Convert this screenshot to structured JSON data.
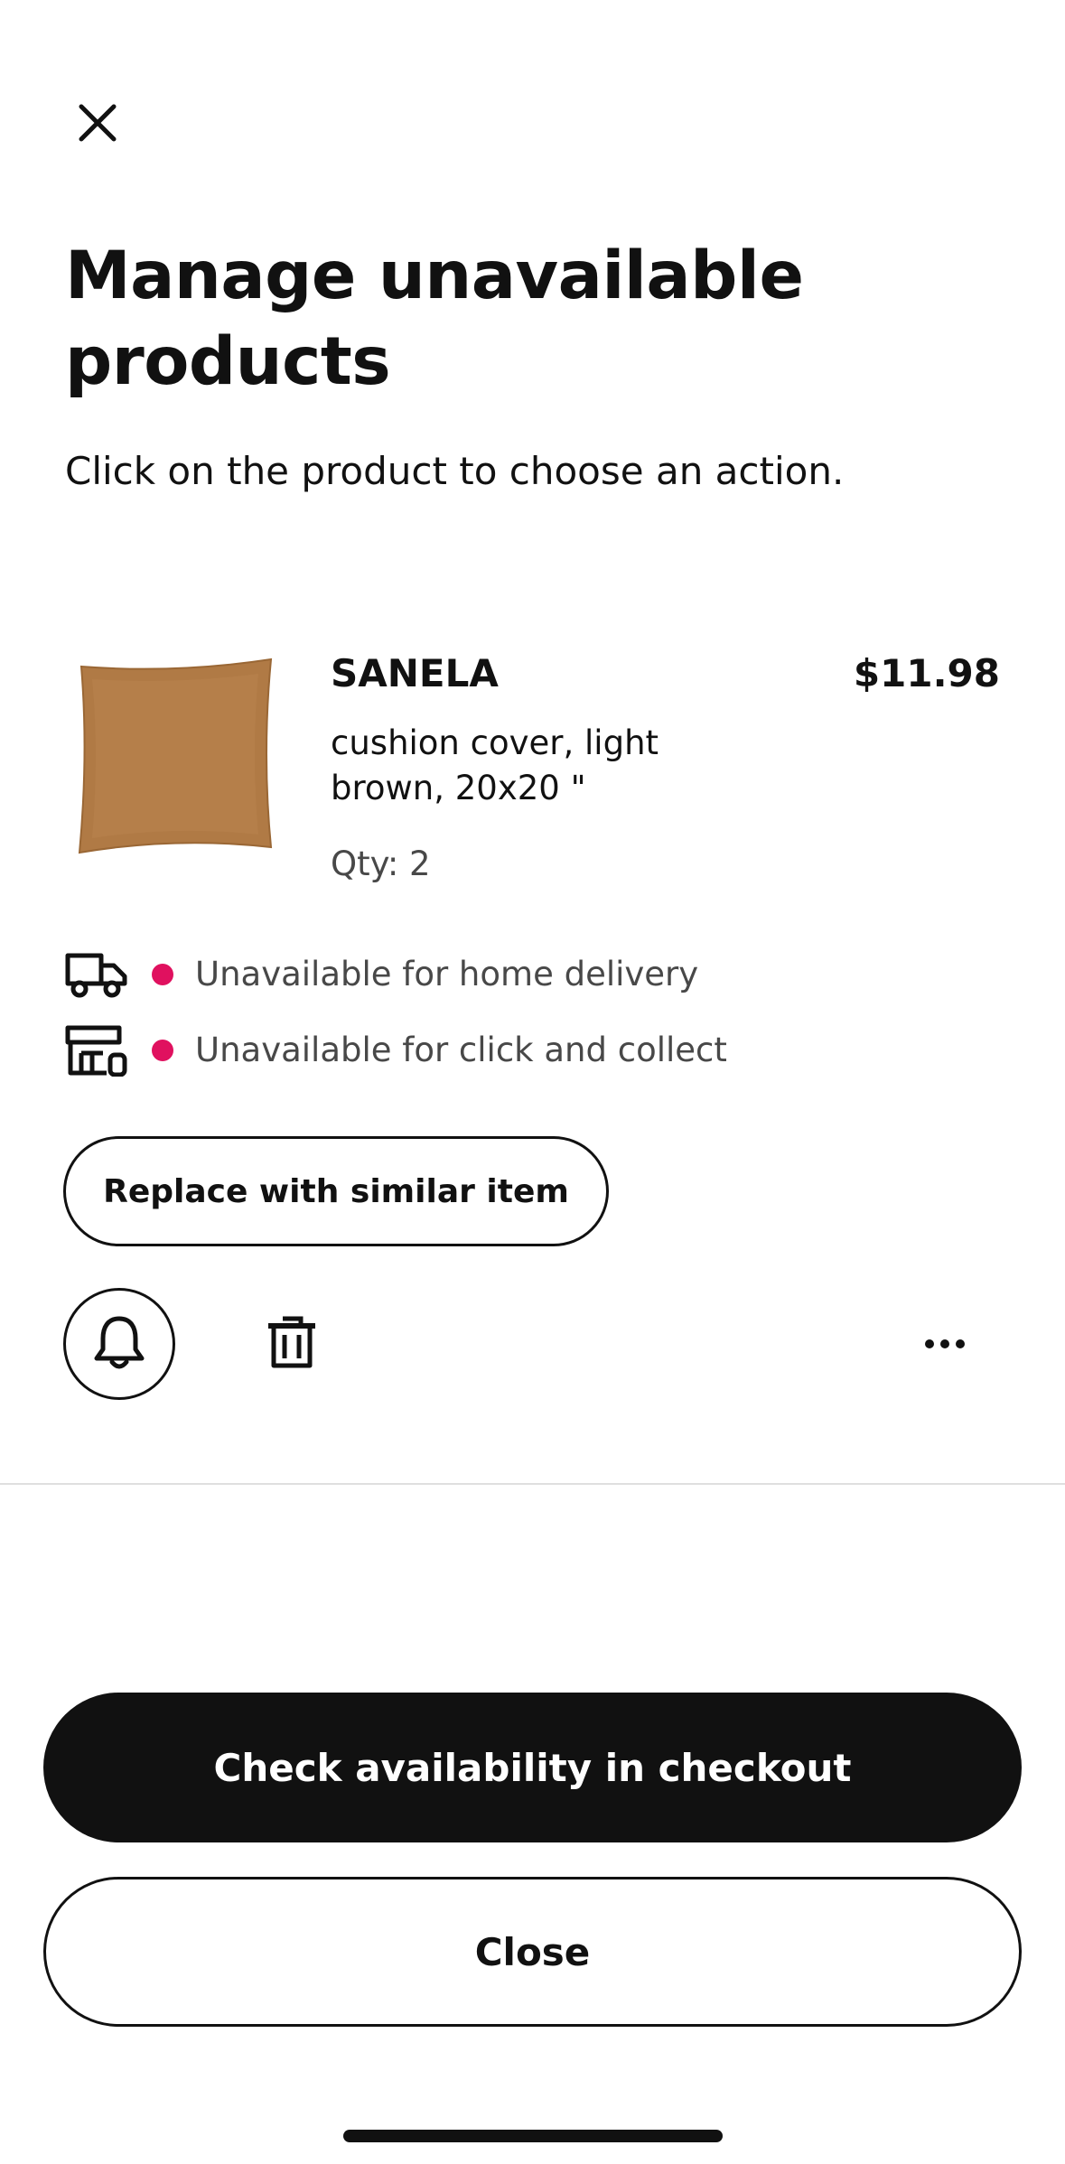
{
  "header": {
    "close_icon": "close-icon",
    "title": "Manage unavailable products",
    "subtitle": "Click on the product to choose an action."
  },
  "product": {
    "name": "SANELA",
    "price": "$11.98",
    "description": "cushion cover, light brown, 20x20 \"",
    "qty": "Qty: 2",
    "image_icon": "cushion-image",
    "image_color": "#b07a45"
  },
  "availability": [
    {
      "icon": "truck-icon",
      "status_color": "#e0115f",
      "text": "Unavailable for home delivery"
    },
    {
      "icon": "store-icon",
      "status_color": "#e0115f",
      "text": "Unavailable for click and collect"
    }
  ],
  "actions": {
    "replace_label": "Replace with similar item",
    "notify_icon": "bell-icon",
    "delete_icon": "trash-icon",
    "more_icon": "more-icon"
  },
  "footer": {
    "primary_label": "Check availability in checkout",
    "secondary_label": "Close"
  },
  "colors": {
    "text": "#111111",
    "muted": "#484848",
    "status_unavailable": "#e0115f",
    "divider": "#dfdfdf"
  }
}
